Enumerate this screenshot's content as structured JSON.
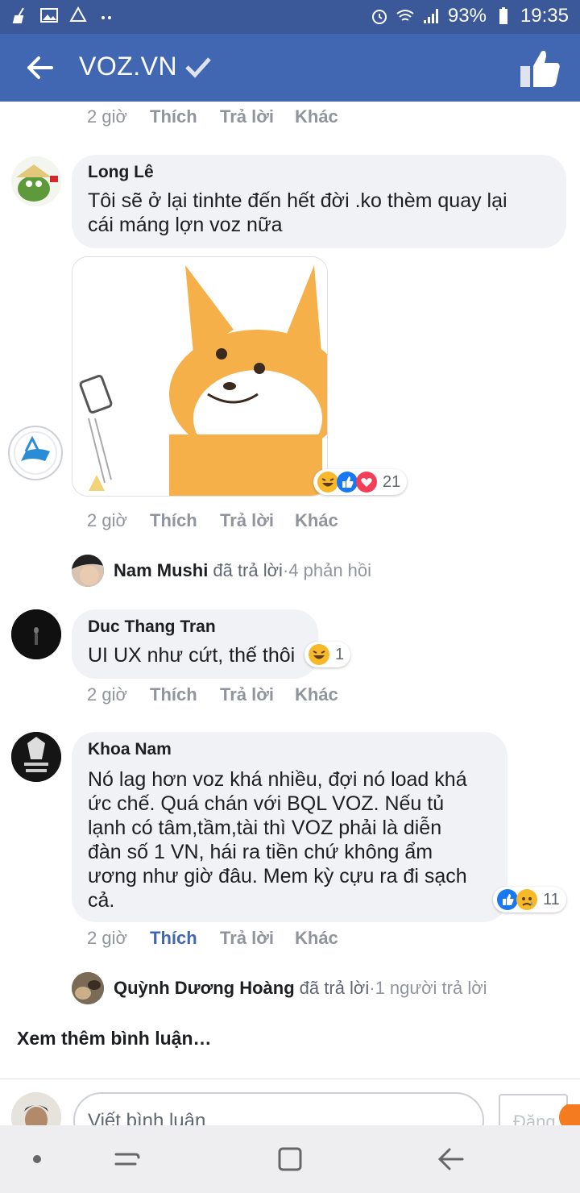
{
  "status": {
    "battery": "93%",
    "time": "19:35"
  },
  "header": {
    "title": "VOZ.VN"
  },
  "comments": [
    {
      "name": "Long Lê",
      "lines": [
        "Tôi sẽ ở lại tinhte đến hết đời .ko thèm quay lại",
        "cái máng lợn voz nữa"
      ]
    },
    {
      "name": "Duc Thang Tran",
      "lines": [
        "UI UX như cứt, thế thôi"
      ]
    },
    {
      "name": "Khoa Nam",
      "lines": [
        "Nó lag hơn voz khá nhiều, đợi nó load khá",
        "ức chế. Quá chán với BQL VOZ. Nếu tủ",
        "lạnh có tâm,tầm,tài thì VOZ phải là diễn",
        "đàn số 1 VN, hái ra tiền chứ không ẩm",
        "ương như giờ đâu. Mem kỳ cựu ra đi sạch",
        "cả."
      ]
    }
  ],
  "image_reactions": {
    "count": "21",
    "icons": [
      "haha-icon",
      "like-icon",
      "love-icon"
    ]
  },
  "duc_reactions": {
    "count": "1",
    "icons": [
      "haha-icon"
    ]
  },
  "khoa_reactions": {
    "count": "11",
    "icons": [
      "like-icon",
      "sad-icon"
    ]
  },
  "actions": {
    "time": "2 giờ",
    "like": "Thích",
    "reply": "Trả lời",
    "more": "Khác"
  },
  "replies": [
    {
      "name": "Nam Mushi",
      "verb": "đã trả lời",
      "sep": " · ",
      "count": "4 phản hồi"
    },
    {
      "name": "Quỳnh Dương Hoàng",
      "verb": "đã trả lời",
      "sep": " · ",
      "count": "1 người trả lời"
    }
  ],
  "see_more": "Xem thêm bình luận…",
  "composer": {
    "placeholder": "Viết bình luận",
    "post": "Đăng"
  },
  "colors": {
    "header": "#4267b2",
    "statusbar": "#3b5998",
    "bubble": "#f0f2f5",
    "liked": "#4267b2",
    "muted": "#90949c"
  }
}
